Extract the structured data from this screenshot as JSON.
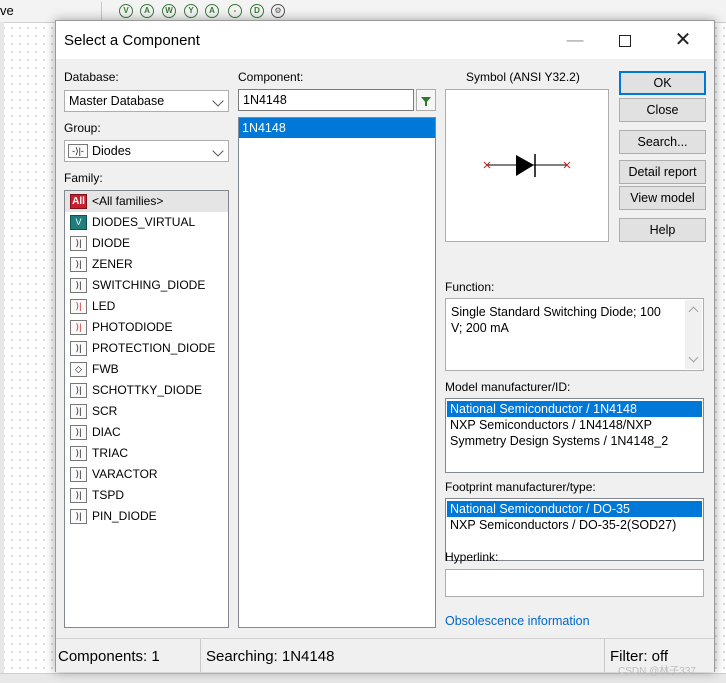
{
  "background": {
    "tab_stub": "ve",
    "toolbar_icons": [
      "V",
      "A",
      "W",
      "Y",
      "A",
      "-",
      "D",
      "gear"
    ]
  },
  "dialog": {
    "title": "Select a Component",
    "min_glyph": "—",
    "close_glyph": "✕"
  },
  "database": {
    "label": "Database:",
    "value": "Master Database"
  },
  "group": {
    "label": "Group:",
    "value": "Diodes"
  },
  "family": {
    "label": "Family:",
    "items": [
      {
        "icon": "All",
        "label": "<All families>"
      },
      {
        "icon": "V",
        "label": "DIODES_VIRTUAL"
      },
      {
        "icon": "⟩|",
        "label": "DIODE"
      },
      {
        "icon": "⟩|",
        "label": "ZENER"
      },
      {
        "icon": "⟩|",
        "label": "SWITCHING_DIODE"
      },
      {
        "icon": "⟩|",
        "label": "LED"
      },
      {
        "icon": "⟩|",
        "label": "PHOTODIODE"
      },
      {
        "icon": "⟩|",
        "label": "PROTECTION_DIODE"
      },
      {
        "icon": "◇",
        "label": "FWB"
      },
      {
        "icon": "⟩|",
        "label": "SCHOTTKY_DIODE"
      },
      {
        "icon": "⟩|",
        "label": "SCR"
      },
      {
        "icon": "⟩|",
        "label": "DIAC"
      },
      {
        "icon": "⟩|",
        "label": "TRIAC"
      },
      {
        "icon": "⟩|",
        "label": "VARACTOR"
      },
      {
        "icon": "⟩|",
        "label": "TSPD"
      },
      {
        "icon": "⟩|",
        "label": "PIN_DIODE"
      }
    ]
  },
  "component": {
    "label": "Component:",
    "search_value": "1N4148",
    "results": [
      "1N4148"
    ]
  },
  "symbol": {
    "label": "Symbol (ANSI Y32.2)"
  },
  "buttons": {
    "ok": "OK",
    "close": "Close",
    "search": "Search...",
    "detail_report": "Detail report",
    "view_model": "View model",
    "help": "Help"
  },
  "function": {
    "label": "Function:",
    "text": "Single Standard Switching Diode; 100 V; 200 mA"
  },
  "model": {
    "label": "Model manufacturer/ID:",
    "items": [
      "National Semiconductor / 1N4148",
      "NXP Semiconductors / 1N4148/NXP",
      "Symmetry Design Systems / 1N4148_2"
    ]
  },
  "footprint": {
    "label": "Footprint manufacturer/type:",
    "items": [
      "National Semiconductor / DO-35",
      "NXP Semiconductors / DO-35-2(SOD27)"
    ]
  },
  "hyperlink": {
    "label": "Hyperlink:",
    "value": ""
  },
  "obsolescence_link": "Obsolescence information",
  "status": {
    "components": "Components: 1",
    "searching": "Searching: 1N4148",
    "filter": "Filter: off"
  },
  "watermark": "CSDN @林子337",
  "colors": {
    "selection": "#0078d7",
    "link": "#0066cc",
    "default_button_border": "#0078d7"
  }
}
